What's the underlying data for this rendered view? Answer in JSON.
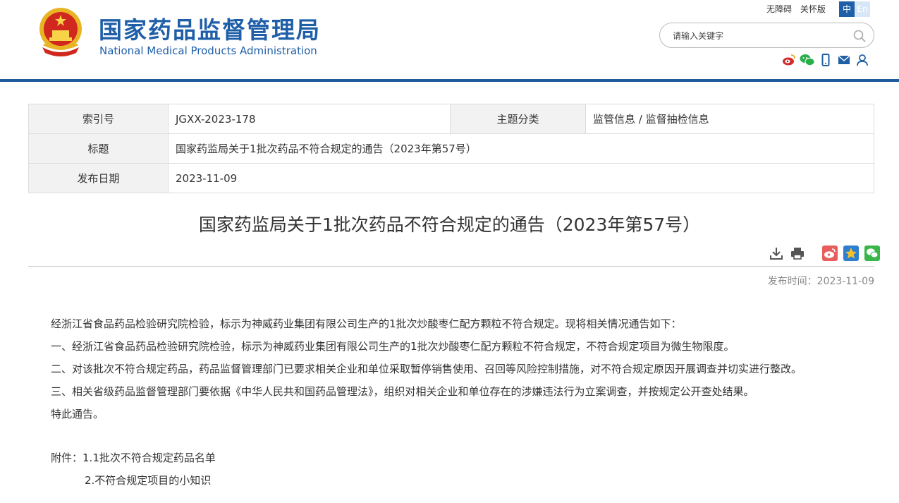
{
  "header": {
    "title_cn": "国家药品监督管理局",
    "title_en": "National Medical Products Administration",
    "top_links": [
      "无障碍",
      "关怀版"
    ],
    "lang_zh": "中",
    "lang_en": "En",
    "search_placeholder": "请输入关键字",
    "icons": [
      "weibo-icon",
      "wechat-icon",
      "mobile-icon",
      "mail-icon",
      "user-icon"
    ],
    "colors": {
      "brand": "#1f5fa8",
      "bar": "#1f5a9c"
    }
  },
  "info_table": {
    "index_label": "索引号",
    "index_value": "JGXX-2023-178",
    "category_label": "主题分类",
    "category_value": "监管信息 / 监督抽检信息",
    "title_label": "标题",
    "title_value": "国家药监局关于1批次药品不符合规定的通告（2023年第57号）",
    "date_label": "发布日期",
    "date_value": "2023-11-09"
  },
  "article": {
    "title": "国家药监局关于1批次药品不符合规定的通告（2023年第57号）",
    "pubtime": "发布时间：2023-11-09",
    "paragraphs": [
      "经浙江省食品药品检验研究院检验，标示为神威药业集团有限公司生产的1批次炒酸枣仁配方颗粒不符合规定。现将相关情况通告如下：",
      "一、经浙江省食品药品检验研究院检验，标示为神威药业集团有限公司生产的1批次炒酸枣仁配方颗粒不符合规定，不符合规定项目为微生物限度。",
      "二、对该批次不符合规定药品，药品监督管理部门已要求相关企业和单位采取暂停销售使用、召回等风险控制措施，对不符合规定原因开展调查并切实进行整改。",
      "三、相关省级药品监督管理部门要依据《中华人民共和国药品管理法》，组织对相关企业和单位存在的涉嫌违法行为立案调查，并按规定公开查处结果。",
      "特此通告。"
    ],
    "attachment_prefix": "附件：",
    "attachments": [
      "1.1批次不符合规定药品名单",
      "2.不符合规定项目的小知识"
    ]
  }
}
